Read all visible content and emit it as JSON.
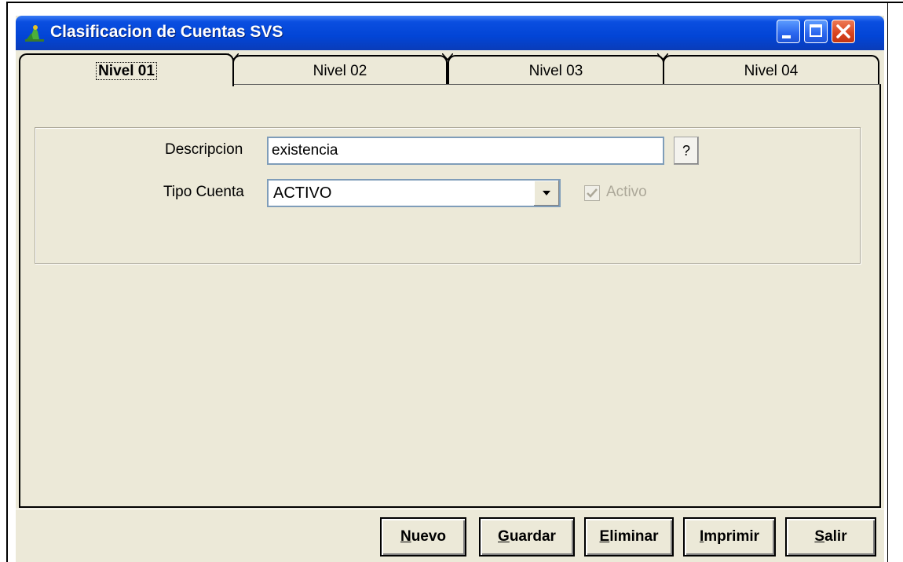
{
  "window": {
    "title": "Clasificacion de Cuentas SVS",
    "controls": {
      "minimize": "minimize-icon",
      "maximize": "maximize-icon",
      "close": "close-icon"
    }
  },
  "tabs": [
    {
      "label": "Nivel 01",
      "selected": true
    },
    {
      "label": "Nivel 02",
      "selected": false
    },
    {
      "label": "Nivel 03",
      "selected": false
    },
    {
      "label": "Nivel 04",
      "selected": false
    }
  ],
  "form": {
    "descripcion_label": "Descripcion",
    "descripcion_value": "existencia",
    "help_button_label": "?",
    "tipo_cuenta_label": "Tipo Cuenta",
    "tipo_cuenta_value": "ACTIVO",
    "activo_label": "Activo",
    "activo_checked": true,
    "activo_enabled": false
  },
  "buttons": {
    "nuevo": {
      "first": "N",
      "rest": "uevo"
    },
    "guardar": {
      "first": "G",
      "rest": "uardar"
    },
    "eliminar": {
      "first": "E",
      "rest": "liminar"
    },
    "imprimir": {
      "first": "I",
      "rest": "mprimir"
    },
    "salir": {
      "first": "S",
      "rest": "alir"
    }
  },
  "colors": {
    "titlebar": "#0245d6",
    "window_bg": "#ece9d8",
    "close_button": "#d8431e"
  }
}
